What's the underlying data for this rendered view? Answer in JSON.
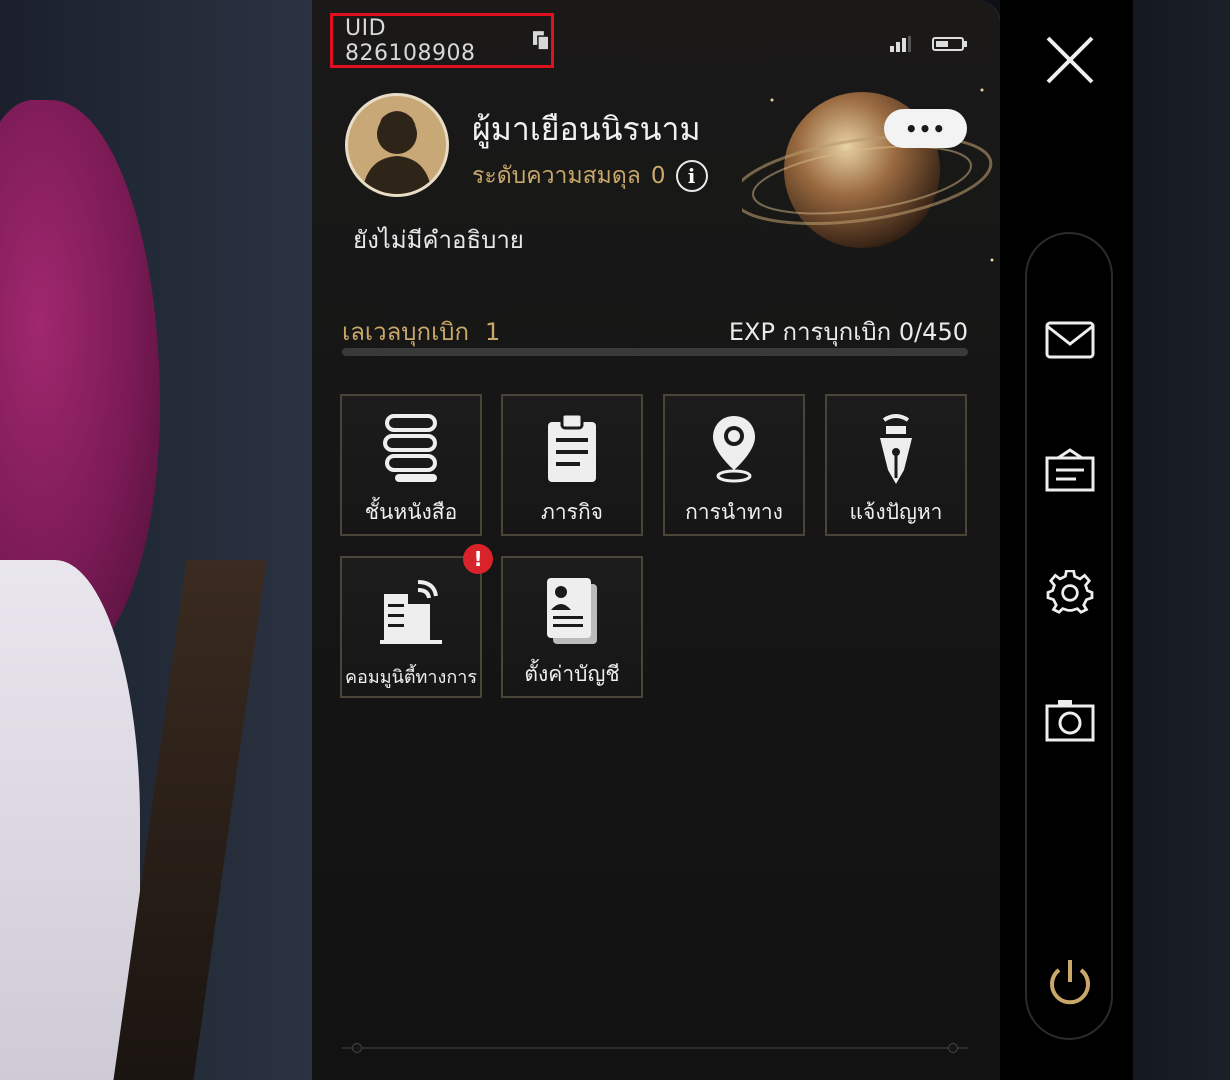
{
  "uid": {
    "label": "UID 826108908"
  },
  "profile": {
    "name": "ผู้มาเยือนนิรนาม",
    "equilibrium_label": "ระดับความสมดุล",
    "equilibrium_value": "0",
    "description": "ยังไม่มีคำอธิบาย",
    "more_label": "•••"
  },
  "trailblaze": {
    "level_label": "เลเวลบุกเบิก",
    "level_value": "1",
    "exp_label": "EXP การบุกเบิก",
    "exp_value": "0/450",
    "exp_fraction": 0
  },
  "menu": [
    {
      "label": "ชั้นหนังสือ",
      "icon": "bookshelf-icon"
    },
    {
      "label": "ภารกิจ",
      "icon": "mission-clipboard-icon"
    },
    {
      "label": "การนำทาง",
      "icon": "navigation-pin-icon"
    },
    {
      "label": "แจ้งปัญหา",
      "icon": "feedback-pen-icon"
    },
    {
      "label": "คอมมูนิตี้ทางการ",
      "icon": "community-building-icon",
      "badge": "!"
    },
    {
      "label": "ตั้งค่าบัญชี",
      "icon": "account-settings-icon"
    }
  ],
  "sidebar": [
    "close-icon",
    "mail-icon",
    "notice-board-icon",
    "settings-gear-icon",
    "camera-icon",
    "power-icon"
  ],
  "colors": {
    "accent_gold": "#c9a86a",
    "highlight_red": "#e01020",
    "badge_red": "#d8232a"
  }
}
